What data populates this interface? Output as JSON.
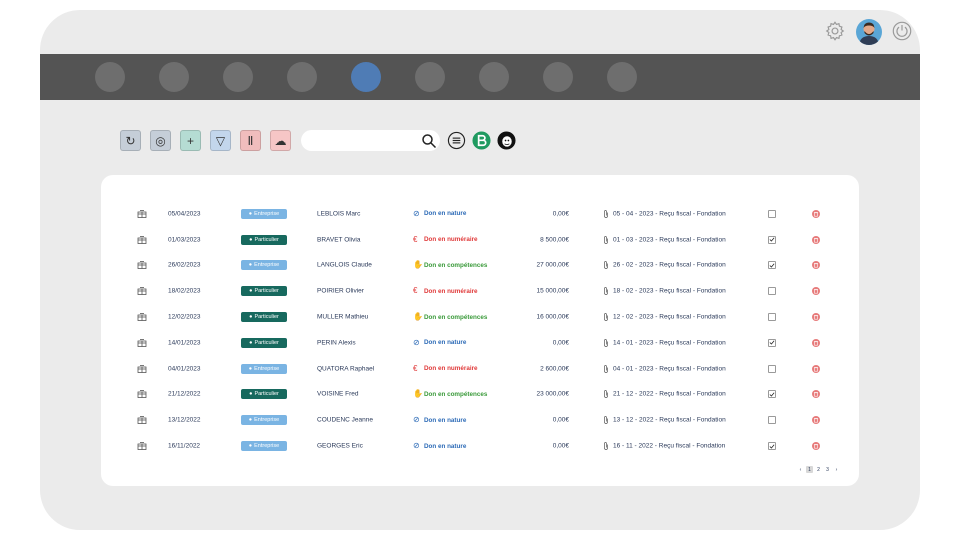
{
  "nav": {
    "count": 9,
    "active_index": 4
  },
  "toolbar": {
    "buttons": [
      {
        "name": "refresh-button",
        "icon": "refresh-icon",
        "glyph": "↻",
        "bg": "#c5ced8"
      },
      {
        "name": "link-button",
        "icon": "link-icon",
        "glyph": "◎",
        "bg": "#c5ced8"
      },
      {
        "name": "add-button",
        "icon": "plus-icon",
        "glyph": "+",
        "bg": "#b5dcd3"
      },
      {
        "name": "filter-button",
        "icon": "filter-icon",
        "glyph": "▽",
        "bg": "#c3d6ec"
      },
      {
        "name": "columns-button",
        "icon": "columns-icon",
        "glyph": "Ⅱ",
        "bg": "#f0bdbd"
      },
      {
        "name": "upload-button",
        "icon": "cloud-upload-icon",
        "glyph": "☁",
        "bg": "#f6c6c6"
      }
    ],
    "search": {
      "value": "",
      "placeholder": ""
    }
  },
  "colors": {
    "frame": "#ebebeb",
    "nav": "#545454",
    "nav_active": "#4f7cb5",
    "entreprise": "#7ab4e3",
    "particulier": "#17695e",
    "nature": "#2d6bb7",
    "numeraire": "#e03a3a",
    "competences": "#3a9a3a"
  },
  "table": {
    "rows": [
      {
        "date": "05/04/2023",
        "badge": "Entreprise",
        "kind": "ent",
        "name": "LEBLOIS Marc",
        "type": "Don en nature",
        "tkind": "nature",
        "amount": "0,00€",
        "receipt": "05 - 04 - 2023 - Reçu fiscal - Fondation",
        "checked": false
      },
      {
        "date": "01/03/2023",
        "badge": "Particulier",
        "kind": "part",
        "name": "BRAVET Olivia",
        "type": "Don en numéraire",
        "tkind": "num",
        "amount": "8 500,00€",
        "receipt": "01 - 03 - 2023 - Reçu fiscal - Fondation",
        "checked": true
      },
      {
        "date": "26/02/2023",
        "badge": "Entreprise",
        "kind": "ent",
        "name": "LANGLOIS Claude",
        "type": "Don en compétences",
        "tkind": "comp",
        "amount": "27 000,00€",
        "receipt": "26 - 02 - 2023 - Reçu fiscal - Fondation",
        "checked": true
      },
      {
        "date": "18/02/2023",
        "badge": "Particulier",
        "kind": "part",
        "name": "POIRIER Olivier",
        "type": "Don en numéraire",
        "tkind": "num",
        "amount": "15 000,00€",
        "receipt": "18 - 02 - 2023 - Reçu fiscal - Fondation",
        "checked": false
      },
      {
        "date": "12/02/2023",
        "badge": "Particulier",
        "kind": "part",
        "name": "MULLER Mathieu",
        "type": "Don en compétences",
        "tkind": "comp",
        "amount": "16 000,00€",
        "receipt": "12 - 02 - 2023 - Reçu fiscal - Fondation",
        "checked": false
      },
      {
        "date": "14/01/2023",
        "badge": "Particulier",
        "kind": "part",
        "name": "PERIN Alexis",
        "type": "Don en nature",
        "tkind": "nature",
        "amount": "0,00€",
        "receipt": "14 - 01 - 2023 - Reçu fiscal - Fondation",
        "checked": true
      },
      {
        "date": "04/01/2023",
        "badge": "Entreprise",
        "kind": "ent",
        "name": "QUATORA Raphael",
        "type": "Don en numéraire",
        "tkind": "num",
        "amount": "2 600,00€",
        "receipt": "04 - 01 - 2023 - Reçu fiscal - Fondation",
        "checked": false
      },
      {
        "date": "21/12/2022",
        "badge": "Particulier",
        "kind": "part",
        "name": "VOISINE Fred",
        "type": "Don en compétences",
        "tkind": "comp",
        "amount": "23 000,00€",
        "receipt": "21 - 12 - 2022 - Reçu fiscal - Fondation",
        "checked": true
      },
      {
        "date": "13/12/2022",
        "badge": "Entreprise",
        "kind": "ent",
        "name": "COUDENC Jeanne",
        "type": "Don en nature",
        "tkind": "nature",
        "amount": "0,00€",
        "receipt": "13 - 12 - 2022 - Reçu fiscal - Fondation",
        "checked": false
      },
      {
        "date": "16/11/2022",
        "badge": "Entreprise",
        "kind": "ent",
        "name": "GEORGES Eric",
        "type": "Don en nature",
        "tkind": "nature",
        "amount": "0,00€",
        "receipt": "16 - 11 - 2022 - Reçu fiscal - Fondation",
        "checked": true
      }
    ]
  },
  "pagination": {
    "prev": "‹",
    "pages": [
      "1",
      "2",
      "3"
    ],
    "current": "1",
    "next": "›"
  }
}
